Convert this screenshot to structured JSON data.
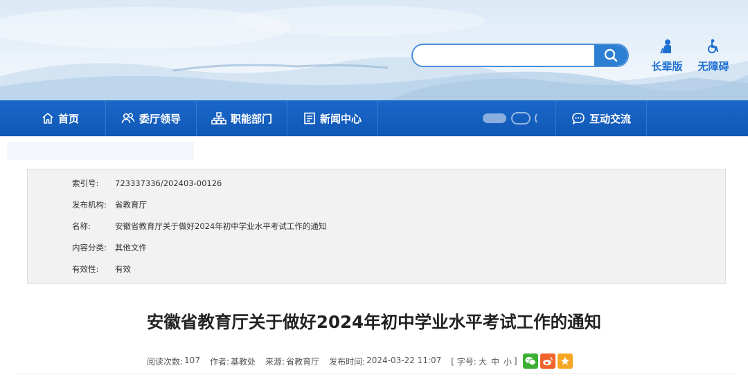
{
  "header": {
    "search": {
      "placeholder": ""
    },
    "elder_label": "长辈版",
    "accessibility_label": "无障碍"
  },
  "nav": {
    "items": [
      {
        "label": "首页",
        "icon": "home-icon"
      },
      {
        "label": "委厅领导",
        "icon": "leaders-icon"
      },
      {
        "label": "职能部门",
        "icon": "org-chart-icon"
      },
      {
        "label": "新闻中心",
        "icon": "news-icon"
      },
      {
        "label": "互动交流",
        "icon": "chat-icon"
      }
    ]
  },
  "meta": [
    {
      "key": "索引号:",
      "value": "723337336/202403-00126"
    },
    {
      "key": "发布机构:",
      "value": "省教育厅"
    },
    {
      "key": "名称:",
      "value": "安徽省教育厅关于做好2024年初中学业水平考试工作的通知"
    },
    {
      "key": "内容分类:",
      "value": "其他文件"
    },
    {
      "key": "有效性:",
      "value": "有效"
    }
  ],
  "article": {
    "title": "安徽省教育厅关于做好2024年初中学业水平考试工作的通知",
    "views_label": "阅读次数:",
    "views": "107",
    "author_label": "作者:",
    "author": "基教处",
    "source_label": "来源:",
    "source": "省教育厅",
    "date_label": "发布时间:",
    "date": "2024-03-22 11:07",
    "fontsize_open": "[ 字号:",
    "fontsize_large": "大",
    "fontsize_medium": "中",
    "fontsize_small": "小",
    "fontsize_close": "]"
  },
  "colors": {
    "nav_bg": "#1466c8",
    "accent": "#2d7fd4",
    "wechat": "#3cb034",
    "weibo": "#f0632b",
    "favorite": "#f5a623"
  }
}
